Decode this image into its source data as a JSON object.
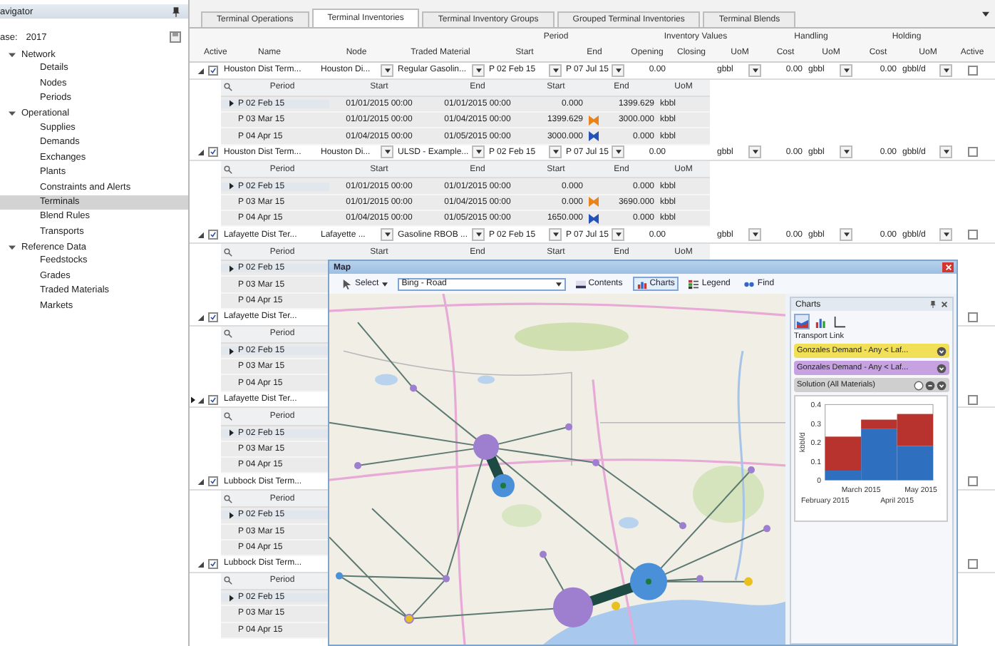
{
  "navigator": {
    "title": "avigator",
    "case_label": "ase:",
    "case_value": "2017",
    "tree": [
      {
        "label": "Network",
        "expanded": true,
        "children": [
          {
            "label": "Details",
            "selected": false
          },
          {
            "label": "Nodes",
            "selected": false
          },
          {
            "label": "Periods",
            "selected": false
          }
        ]
      },
      {
        "label": "Operational",
        "expanded": true,
        "children": [
          {
            "label": "Supplies",
            "selected": false
          },
          {
            "label": "Demands",
            "selected": false
          },
          {
            "label": "Exchanges",
            "selected": false
          },
          {
            "label": "Plants",
            "selected": false
          },
          {
            "label": "Constraints and Alerts",
            "selected": false
          },
          {
            "label": "Terminals",
            "selected": true
          },
          {
            "label": "Blend Rules",
            "selected": false
          },
          {
            "label": "Transports",
            "selected": false
          }
        ]
      },
      {
        "label": "Reference Data",
        "expanded": true,
        "children": [
          {
            "label": "Feedstocks",
            "selected": false
          },
          {
            "label": "Grades",
            "selected": false
          },
          {
            "label": "Traded Materials",
            "selected": false
          },
          {
            "label": "Markets",
            "selected": false
          }
        ]
      }
    ]
  },
  "tabs": [
    {
      "label": "Terminal Operations",
      "selected": false
    },
    {
      "label": "Terminal Inventories",
      "selected": true
    },
    {
      "label": "Terminal Inventory Groups",
      "selected": false
    },
    {
      "label": "Grouped Terminal Inventories",
      "selected": false
    },
    {
      "label": "Terminal Blends",
      "selected": false
    }
  ],
  "grid": {
    "group_headers": [
      "Period",
      "Inventory Values",
      "Handling",
      "Holding"
    ],
    "columns": [
      "Active",
      "Name",
      "Node",
      "Traded Material",
      "Start",
      "End",
      "Opening",
      "Closing",
      "UoM",
      "Cost",
      "UoM",
      "Cost",
      "UoM",
      "Active"
    ],
    "rows": [
      {
        "current": false,
        "expanded": true,
        "active": true,
        "name": "Houston Dist Term...",
        "node": "Houston Di...",
        "traded_material": "Regular Gasolin...",
        "start": "P 02 Feb 15",
        "end": "P 07 Jul 15",
        "opening": "0.00",
        "uom": "gbbl",
        "handling_cost": "0.00",
        "handling_uom": "gbbl",
        "holding_cost": "0.00",
        "holding_uom": "gbbl/d",
        "active_right": false,
        "sub_columns": [
          "Period",
          "Start",
          "End",
          "Start",
          "End",
          "UoM"
        ],
        "periods": [
          {
            "current": true,
            "period": "P 02 Feb 15",
            "start": "01/01/2015 00:00",
            "end": "01/01/2015 00:00",
            "start_value": "0.000",
            "end_value": "1399.629",
            "uom": "kbbl"
          },
          {
            "current": false,
            "period": "P 03 Mar 15",
            "start": "01/01/2015 00:00",
            "end": "01/04/2015 00:00",
            "start_value": "1399.629",
            "color": "#e8841e",
            "end_value": "3000.000",
            "uom": "kbbl"
          },
          {
            "current": false,
            "period": "P 04 Apr 15",
            "start": "01/04/2015 00:00",
            "end": "01/05/2015 00:00",
            "start_value": "3000.000",
            "color": "#2452b8",
            "end_value": "0.000",
            "uom": "kbbl"
          }
        ]
      },
      {
        "current": false,
        "expanded": true,
        "active": true,
        "name": "Houston Dist Term...",
        "node": "Houston Di...",
        "traded_material": "ULSD - Example...",
        "start": "P 02 Feb 15",
        "end": "P 07 Jul 15",
        "opening": "0.00",
        "uom": "gbbl",
        "handling_cost": "0.00",
        "handling_uom": "gbbl",
        "holding_cost": "0.00",
        "holding_uom": "gbbl/d",
        "active_right": false,
        "sub_columns": [
          "Period",
          "Start",
          "End",
          "Start",
          "End",
          "UoM"
        ],
        "periods": [
          {
            "current": true,
            "period": "P 02 Feb 15",
            "start": "01/01/2015 00:00",
            "end": "01/01/2015 00:00",
            "start_value": "0.000",
            "end_value": "0.000",
            "uom": "kbbl"
          },
          {
            "current": false,
            "period": "P 03 Mar 15",
            "start": "01/01/2015 00:00",
            "end": "01/04/2015 00:00",
            "start_value": "0.000",
            "color": "#e8841e",
            "end_value": "3690.000",
            "uom": "kbbl"
          },
          {
            "current": false,
            "period": "P 04 Apr 15",
            "start": "01/04/2015 00:00",
            "end": "01/05/2015 00:00",
            "start_value": "1650.000",
            "color": "#2452b8",
            "end_value": "0.000",
            "uom": "kbbl"
          }
        ]
      },
      {
        "current": false,
        "expanded": true,
        "active": true,
        "name": "Lafayette Dist Ter...",
        "node": "Lafayette ...",
        "traded_material": "Gasoline RBOB ...",
        "start": "P 02 Feb 15",
        "end": "P 07 Jul 15",
        "opening": "0.00",
        "uom": "gbbl",
        "handling_cost": "0.00",
        "handling_uom": "gbbl",
        "holding_cost": "0.00",
        "holding_uom": "gbbl/d",
        "active_right": false,
        "sub_columns": [
          "Period",
          "Start",
          "End",
          "Start",
          "End",
          "UoM"
        ],
        "periods": [
          {
            "current": true,
            "period": "P 02 Feb 15"
          },
          {
            "current": false,
            "period": "P 03 Mar 15"
          },
          {
            "current": false,
            "period": "P 04 Apr 15"
          }
        ]
      },
      {
        "current": false,
        "expanded": true,
        "active": true,
        "name": "Lafayette Dist Ter...",
        "active_right": false,
        "sub_columns": [
          "Period"
        ],
        "periods": [
          {
            "current": true,
            "period": "P 02 Feb 15"
          },
          {
            "current": false,
            "period": "P 03 Mar 15"
          },
          {
            "current": false,
            "period": "P 04 Apr 15"
          }
        ]
      },
      {
        "current": true,
        "expanded": true,
        "active": true,
        "name": "Lafayette Dist Ter...",
        "active_right": false,
        "sub_columns": [
          "Period"
        ],
        "periods": [
          {
            "current": true,
            "period": "P 02 Feb 15"
          },
          {
            "current": false,
            "period": "P 03 Mar 15"
          },
          {
            "current": false,
            "period": "P 04 Apr 15"
          }
        ]
      },
      {
        "current": false,
        "expanded": true,
        "active": true,
        "name": "Lubbock Dist Term...",
        "active_right": false,
        "sub_columns": [
          "Period"
        ],
        "periods": [
          {
            "current": true,
            "period": "P 02 Feb 15"
          },
          {
            "current": false,
            "period": "P 03 Mar 15"
          },
          {
            "current": false,
            "period": "P 04 Apr 15"
          }
        ]
      },
      {
        "current": false,
        "expanded": true,
        "active": true,
        "name": "Lubbock Dist Term...",
        "active_right": false,
        "sub_columns": [
          "Period"
        ],
        "periods": [
          {
            "current": true,
            "period": "P 02 Feb 15"
          },
          {
            "current": false,
            "period": "P 03 Mar 15"
          },
          {
            "current": false,
            "period": "P 04 Apr 15"
          }
        ]
      }
    ]
  },
  "map": {
    "title": "Map",
    "tool": "Select",
    "layer": "Bing - Road",
    "toggles": [
      {
        "label": "Contents",
        "kind": "contents",
        "selected": false
      },
      {
        "label": "Charts",
        "kind": "charts",
        "selected": true
      },
      {
        "label": "Legend",
        "kind": "legend",
        "selected": false
      },
      {
        "label": "Find",
        "kind": "find",
        "selected": false
      }
    ],
    "charts_panel": {
      "title": "Charts",
      "views": [
        {
          "kind": "area",
          "selected": true
        },
        {
          "kind": "bar",
          "selected": false
        },
        {
          "kind": "line",
          "selected": false
        }
      ],
      "caption": "Transport Link",
      "series": [
        {
          "label": "Gonzales Demand - Any < Laf...",
          "color": "#f2df58",
          "kind": "single"
        },
        {
          "label": "Gonzales Demand - Any < Laf...",
          "color": "#c6a3e0",
          "kind": "single"
        },
        {
          "label": "Solution (All Materials)",
          "color": "#cfcfcf",
          "kind": "solution"
        }
      ],
      "chart_data": {
        "type": "bar",
        "stacked": true,
        "ylabel": "kbbl/d",
        "yticks": [
          0,
          0.1,
          0.2,
          0.3,
          0.4
        ],
        "ylim": [
          0,
          0.4
        ],
        "categories": [
          "February 2015",
          "March 2015",
          "April 2015",
          "May 2015"
        ],
        "series": [
          {
            "color": "#2f6fc0",
            "values": [
              0.05,
              0.27,
              0.18,
              null
            ]
          },
          {
            "color": "#b8332e",
            "values": [
              0.18,
              0.05,
              0.17,
              null
            ]
          }
        ]
      }
    }
  }
}
